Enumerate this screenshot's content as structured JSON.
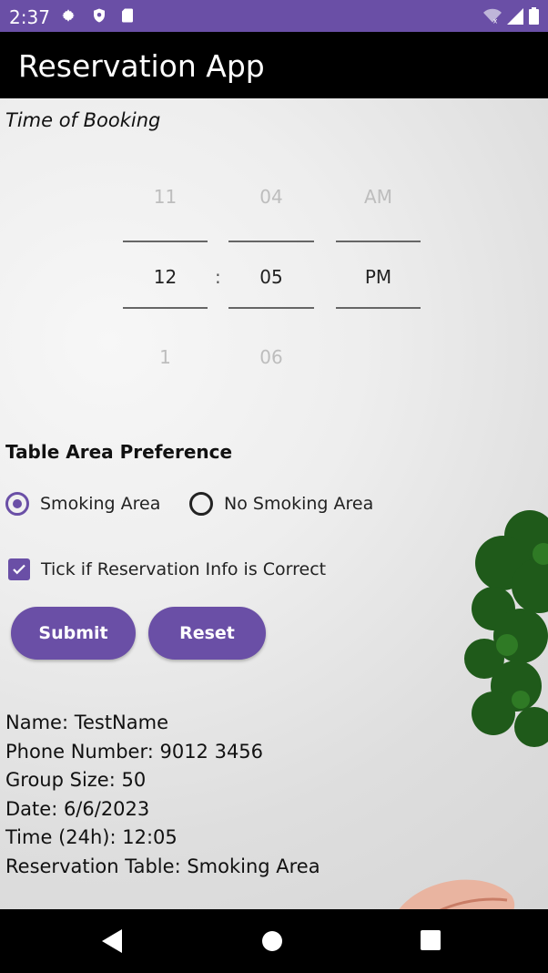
{
  "status_bar": {
    "time": "2:37",
    "icons": [
      "gear-icon",
      "shield-icon",
      "sd-card-icon",
      "wifi-icon",
      "signal-icon",
      "battery-icon"
    ]
  },
  "app_bar": {
    "title": "Reservation App"
  },
  "booking": {
    "label": "Time of Booking",
    "picker": {
      "hour_prev": "11",
      "hour": "12",
      "hour_next": "1",
      "separator": ":",
      "minute_prev": "04",
      "minute": "05",
      "minute_next": "06",
      "ampm_prev": "AM",
      "ampm": "PM"
    }
  },
  "table_pref": {
    "title": "Table Area Preference",
    "options": [
      {
        "label": "Smoking Area",
        "selected": true
      },
      {
        "label": "No Smoking Area",
        "selected": false
      }
    ]
  },
  "confirm": {
    "label": "Tick if Reservation Info is Correct",
    "checked": true
  },
  "buttons": {
    "submit": "Submit",
    "reset": "Reset"
  },
  "summary": {
    "name": "Name: TestName",
    "phone": "Phone Number: 9012 3456",
    "group": "Group Size: 50",
    "date": "Date: 6/6/2023",
    "time": "Time (24h): 12:05",
    "table": "Reservation Table: Smoking Area"
  },
  "colors": {
    "accent": "#6a4fa6",
    "status_bar": "#6a4fa6",
    "app_bar": "#000000"
  }
}
